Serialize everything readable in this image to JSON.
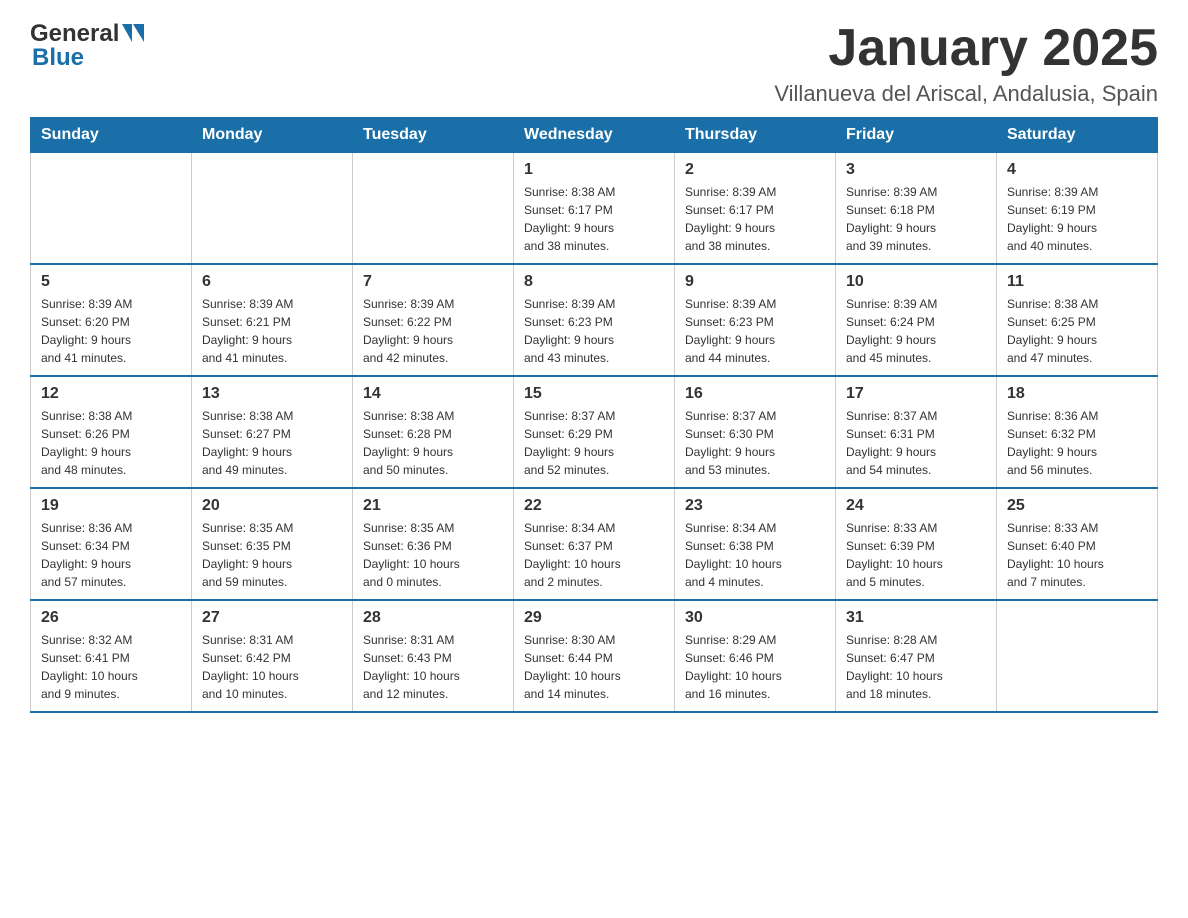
{
  "header": {
    "logo_general": "General",
    "logo_blue": "Blue",
    "title": "January 2025",
    "subtitle": "Villanueva del Ariscal, Andalusia, Spain"
  },
  "calendar": {
    "days_of_week": [
      "Sunday",
      "Monday",
      "Tuesday",
      "Wednesday",
      "Thursday",
      "Friday",
      "Saturday"
    ],
    "weeks": [
      [
        {
          "day": "",
          "info": ""
        },
        {
          "day": "",
          "info": ""
        },
        {
          "day": "",
          "info": ""
        },
        {
          "day": "1",
          "info": "Sunrise: 8:38 AM\nSunset: 6:17 PM\nDaylight: 9 hours\nand 38 minutes."
        },
        {
          "day": "2",
          "info": "Sunrise: 8:39 AM\nSunset: 6:17 PM\nDaylight: 9 hours\nand 38 minutes."
        },
        {
          "day": "3",
          "info": "Sunrise: 8:39 AM\nSunset: 6:18 PM\nDaylight: 9 hours\nand 39 minutes."
        },
        {
          "day": "4",
          "info": "Sunrise: 8:39 AM\nSunset: 6:19 PM\nDaylight: 9 hours\nand 40 minutes."
        }
      ],
      [
        {
          "day": "5",
          "info": "Sunrise: 8:39 AM\nSunset: 6:20 PM\nDaylight: 9 hours\nand 41 minutes."
        },
        {
          "day": "6",
          "info": "Sunrise: 8:39 AM\nSunset: 6:21 PM\nDaylight: 9 hours\nand 41 minutes."
        },
        {
          "day": "7",
          "info": "Sunrise: 8:39 AM\nSunset: 6:22 PM\nDaylight: 9 hours\nand 42 minutes."
        },
        {
          "day": "8",
          "info": "Sunrise: 8:39 AM\nSunset: 6:23 PM\nDaylight: 9 hours\nand 43 minutes."
        },
        {
          "day": "9",
          "info": "Sunrise: 8:39 AM\nSunset: 6:23 PM\nDaylight: 9 hours\nand 44 minutes."
        },
        {
          "day": "10",
          "info": "Sunrise: 8:39 AM\nSunset: 6:24 PM\nDaylight: 9 hours\nand 45 minutes."
        },
        {
          "day": "11",
          "info": "Sunrise: 8:38 AM\nSunset: 6:25 PM\nDaylight: 9 hours\nand 47 minutes."
        }
      ],
      [
        {
          "day": "12",
          "info": "Sunrise: 8:38 AM\nSunset: 6:26 PM\nDaylight: 9 hours\nand 48 minutes."
        },
        {
          "day": "13",
          "info": "Sunrise: 8:38 AM\nSunset: 6:27 PM\nDaylight: 9 hours\nand 49 minutes."
        },
        {
          "day": "14",
          "info": "Sunrise: 8:38 AM\nSunset: 6:28 PM\nDaylight: 9 hours\nand 50 minutes."
        },
        {
          "day": "15",
          "info": "Sunrise: 8:37 AM\nSunset: 6:29 PM\nDaylight: 9 hours\nand 52 minutes."
        },
        {
          "day": "16",
          "info": "Sunrise: 8:37 AM\nSunset: 6:30 PM\nDaylight: 9 hours\nand 53 minutes."
        },
        {
          "day": "17",
          "info": "Sunrise: 8:37 AM\nSunset: 6:31 PM\nDaylight: 9 hours\nand 54 minutes."
        },
        {
          "day": "18",
          "info": "Sunrise: 8:36 AM\nSunset: 6:32 PM\nDaylight: 9 hours\nand 56 minutes."
        }
      ],
      [
        {
          "day": "19",
          "info": "Sunrise: 8:36 AM\nSunset: 6:34 PM\nDaylight: 9 hours\nand 57 minutes."
        },
        {
          "day": "20",
          "info": "Sunrise: 8:35 AM\nSunset: 6:35 PM\nDaylight: 9 hours\nand 59 minutes."
        },
        {
          "day": "21",
          "info": "Sunrise: 8:35 AM\nSunset: 6:36 PM\nDaylight: 10 hours\nand 0 minutes."
        },
        {
          "day": "22",
          "info": "Sunrise: 8:34 AM\nSunset: 6:37 PM\nDaylight: 10 hours\nand 2 minutes."
        },
        {
          "day": "23",
          "info": "Sunrise: 8:34 AM\nSunset: 6:38 PM\nDaylight: 10 hours\nand 4 minutes."
        },
        {
          "day": "24",
          "info": "Sunrise: 8:33 AM\nSunset: 6:39 PM\nDaylight: 10 hours\nand 5 minutes."
        },
        {
          "day": "25",
          "info": "Sunrise: 8:33 AM\nSunset: 6:40 PM\nDaylight: 10 hours\nand 7 minutes."
        }
      ],
      [
        {
          "day": "26",
          "info": "Sunrise: 8:32 AM\nSunset: 6:41 PM\nDaylight: 10 hours\nand 9 minutes."
        },
        {
          "day": "27",
          "info": "Sunrise: 8:31 AM\nSunset: 6:42 PM\nDaylight: 10 hours\nand 10 minutes."
        },
        {
          "day": "28",
          "info": "Sunrise: 8:31 AM\nSunset: 6:43 PM\nDaylight: 10 hours\nand 12 minutes."
        },
        {
          "day": "29",
          "info": "Sunrise: 8:30 AM\nSunset: 6:44 PM\nDaylight: 10 hours\nand 14 minutes."
        },
        {
          "day": "30",
          "info": "Sunrise: 8:29 AM\nSunset: 6:46 PM\nDaylight: 10 hours\nand 16 minutes."
        },
        {
          "day": "31",
          "info": "Sunrise: 8:28 AM\nSunset: 6:47 PM\nDaylight: 10 hours\nand 18 minutes."
        },
        {
          "day": "",
          "info": ""
        }
      ]
    ]
  }
}
